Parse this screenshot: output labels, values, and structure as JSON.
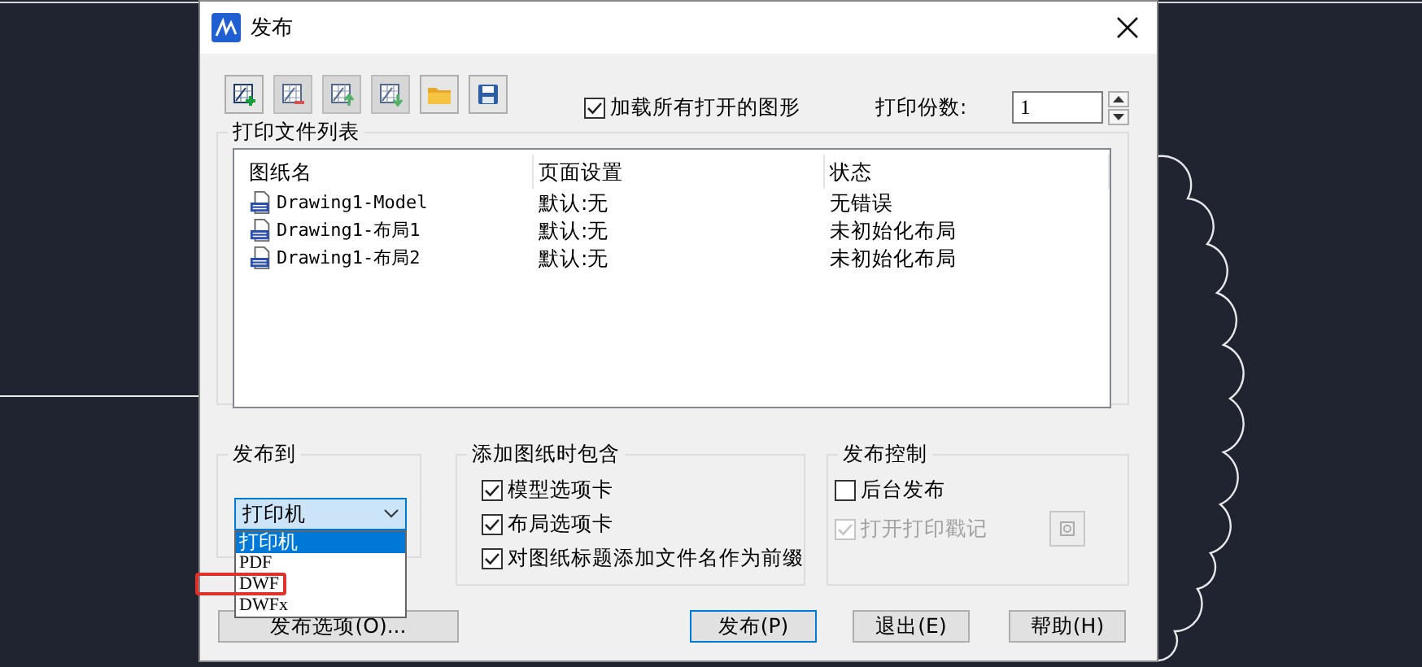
{
  "window": {
    "title": "发布"
  },
  "toolbar": [
    {
      "kind": "add",
      "disabled": false
    },
    {
      "kind": "remove",
      "disabled": true
    },
    {
      "kind": "up",
      "disabled": true
    },
    {
      "kind": "down",
      "disabled": true
    },
    {
      "kind": "folder",
      "disabled": false
    },
    {
      "kind": "save",
      "disabled": false
    }
  ],
  "load_all": {
    "label": "加载所有打开的图形",
    "checked": true
  },
  "copies": {
    "label": "打印份数:",
    "value": "1"
  },
  "file_list": {
    "title": "打印文件列表",
    "columns": [
      "图纸名",
      "页面设置",
      "状态"
    ],
    "rows": [
      {
        "cells": [
          "Drawing1-Model",
          "默认:无",
          "无错误"
        ]
      },
      {
        "cells": [
          "Drawing1-布局1",
          "默认:无",
          "未初始化布局"
        ]
      },
      {
        "cells": [
          "Drawing1-布局2",
          "默认:无",
          "未初始化布局"
        ]
      }
    ]
  },
  "publish_to": {
    "title": "发布到",
    "value": "打印机",
    "open": true,
    "options": [
      {
        "label": "打印机",
        "selected": true,
        "highlighted": false
      },
      {
        "label": "PDF",
        "selected": false,
        "highlighted": false
      },
      {
        "label": "DWF",
        "selected": false,
        "highlighted": true
      },
      {
        "label": "DWFx",
        "selected": false,
        "highlighted": false
      }
    ]
  },
  "include": {
    "title": "添加图纸时包含",
    "options": [
      {
        "label": "模型选项卡",
        "checked": true
      },
      {
        "label": "布局选项卡",
        "checked": true
      },
      {
        "label": "对图纸标题添加文件名作为前缀",
        "checked": true
      }
    ]
  },
  "control": {
    "title": "发布控制",
    "options": [
      {
        "label": "后台发布",
        "checked": false,
        "disabled": false
      },
      {
        "label": "打开打印戳记",
        "checked": true,
        "disabled": true
      }
    ]
  },
  "buttons": [
    {
      "label": "发布选项(O)...",
      "default": false
    },
    {
      "label": "发布(P)",
      "default": true
    },
    {
      "label": "退出(E)",
      "default": false
    },
    {
      "label": "帮助(H)",
      "default": false
    }
  ]
}
